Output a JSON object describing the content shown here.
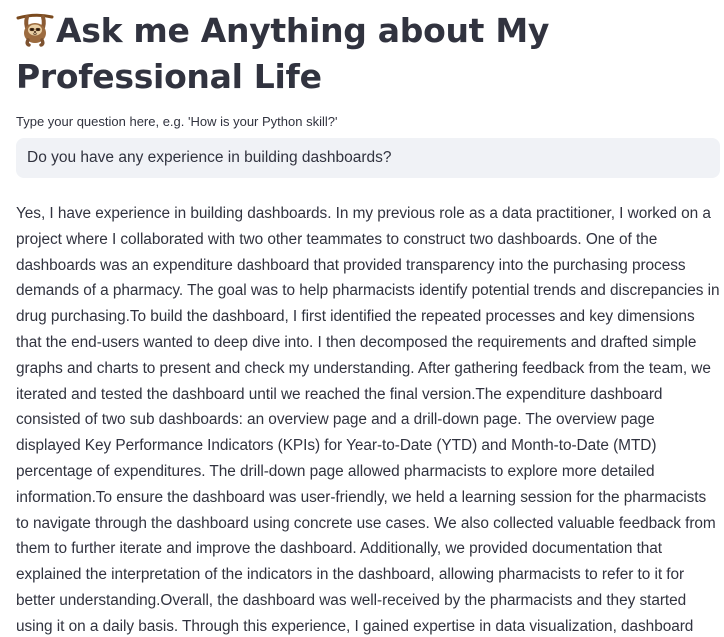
{
  "header": {
    "icon": "sloth-icon",
    "title": "Ask me Anything about My Professional Life"
  },
  "question": {
    "label": "Type your question here, e.g. 'How is your Python skill?'",
    "value": "Do you have any experience in building dashboards?"
  },
  "answer": {
    "text": "Yes, I have experience in building dashboards. In my previous role as a data practitioner, I worked on a project where I collaborated with two other teammates to construct two dashboards. One of the dashboards was an expenditure dashboard that provided transparency into the purchasing process demands of a pharmacy. The goal was to help pharmacists identify potential trends and discrepancies in drug purchasing.To build the dashboard, I first identified the repeated processes and key dimensions that the end-users wanted to deep dive into. I then decomposed the requirements and drafted simple graphs and charts to present and check my understanding. After gathering feedback from the team, we iterated and tested the dashboard until we reached the final version.The expenditure dashboard consisted of two sub dashboards: an overview page and a drill-down page. The overview page displayed Key Performance Indicators (KPIs) for Year-to-Date (YTD) and Month-to-Date (MTD) percentage of expenditures. The drill-down page allowed pharmacists to explore more detailed information.To ensure the dashboard was user-friendly, we held a learning session for the pharmacists to navigate through the dashboard using concrete use cases. We also collected valuable feedback from them to further iterate and improve the dashboard. Additionally, we provided documentation that explained the interpretation of the indicators in the dashboard, allowing pharmacists to refer to it for better understanding.Overall, the dashboard was well-received by the pharmacists and they started using it on a daily basis. Through this experience, I gained expertise in data visualization, dashboard design, and user feedback collection."
  }
}
